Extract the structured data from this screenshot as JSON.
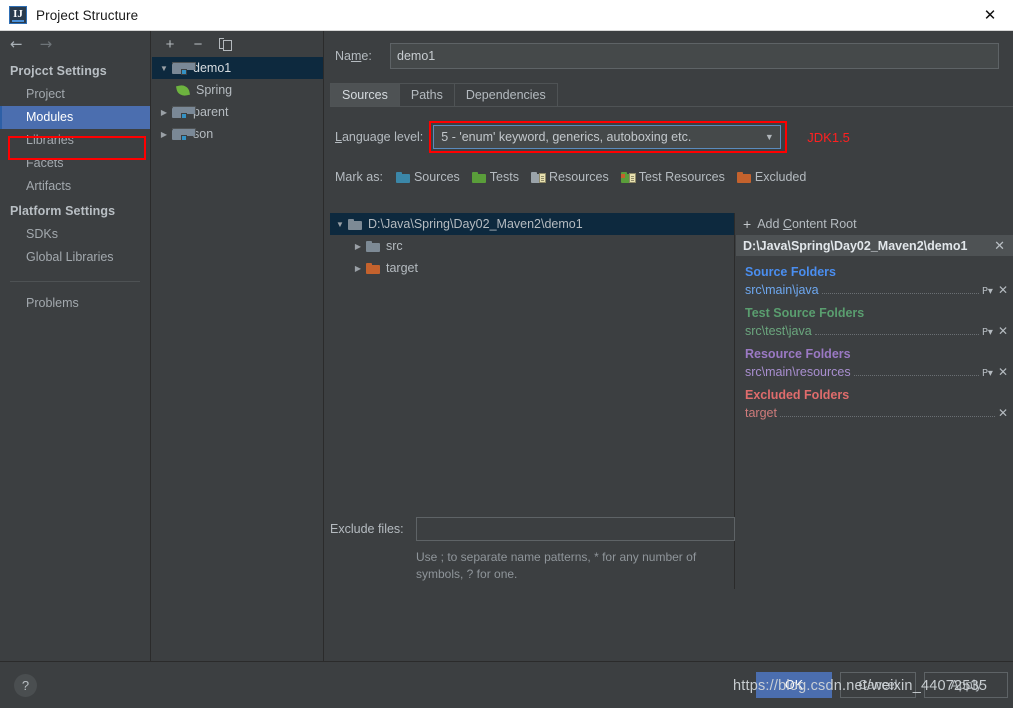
{
  "window": {
    "title": "Project Structure",
    "app_icon": "intellij-idea-icon",
    "close_label": "✕"
  },
  "sidebar": {
    "back_arrow": "←",
    "forward_arrow": "→",
    "groups": [
      {
        "title": "Projcct Settings",
        "items": [
          {
            "label": "Project",
            "selected": false
          },
          {
            "label": "Modules",
            "selected": true
          },
          {
            "label": "Libraries",
            "selected": false
          },
          {
            "label": "Facets",
            "selected": false
          },
          {
            "label": "Artifacts",
            "selected": false
          }
        ]
      },
      {
        "title": "Platform Settings",
        "items": [
          {
            "label": "SDKs",
            "selected": false
          },
          {
            "label": "Global Libraries",
            "selected": false
          }
        ]
      }
    ],
    "problems": "Problems"
  },
  "modules": {
    "toolbar": {
      "add": "+",
      "remove": "−",
      "copy": "copy"
    },
    "tree": [
      {
        "label": "demo1",
        "type": "module",
        "expanded": true,
        "selected": true,
        "indent": 0
      },
      {
        "label": "Spring",
        "type": "facet",
        "expanded": null,
        "selected": false,
        "indent": 1
      },
      {
        "label": "parent",
        "type": "module",
        "expanded": false,
        "selected": false,
        "indent": 0
      },
      {
        "label": "son",
        "type": "module",
        "expanded": false,
        "selected": false,
        "indent": 0
      }
    ]
  },
  "main": {
    "name_label_pre": "Na",
    "name_label_underline": "m",
    "name_label_post": "e:",
    "name_value": "demo1",
    "tabs": [
      {
        "label": "Sources",
        "active": true
      },
      {
        "label": "Paths",
        "active": false
      },
      {
        "label": "Dependencies",
        "active": false
      }
    ],
    "language_level": {
      "label_underline": "L",
      "label_rest": "anguage level:",
      "value": "5 - 'enum' keyword, generics, autoboxing etc.",
      "arrow": "▼",
      "annotation": "JDK1.5"
    },
    "mark_as": {
      "label": "Mark as:",
      "options": [
        {
          "label": "Sources",
          "accel": "S",
          "rest": "ources",
          "icon": "folder-blue-icon"
        },
        {
          "label": "Tests",
          "accel": "T",
          "rest": "ests",
          "icon": "folder-green-icon"
        },
        {
          "label": "Resources",
          "accel": "",
          "rest": "Resources",
          "icon": "folder-resources-icon"
        },
        {
          "label": "Test Resources",
          "accel": "",
          "rest": "Test Resources",
          "icon": "folder-test-resources-icon"
        },
        {
          "label": "Excluded",
          "accel": "E",
          "rest": "xcluded",
          "icon": "folder-orange-icon"
        }
      ]
    },
    "root_tree": [
      {
        "label": "D:\\Java\\Spring\\Day02_Maven2\\demo1",
        "expanded": true,
        "selected": true,
        "indent": 0,
        "icon": "folder-gray-icon"
      },
      {
        "label": "src",
        "expanded": false,
        "selected": false,
        "indent": 1,
        "icon": "folder-gray-icon"
      },
      {
        "label": "target",
        "expanded": false,
        "selected": false,
        "indent": 1,
        "icon": "folder-orange-icon"
      }
    ],
    "exclude_files": {
      "label": "Exclude files:",
      "value": "",
      "placeholder": "",
      "hint": "Use ; to separate name patterns, * for any number of symbols, ? for one."
    }
  },
  "content_roots": {
    "add_button": {
      "plus": "+",
      "label_pre": "Add ",
      "label_accel": "C",
      "label_post": "ontent Root"
    },
    "root_path": "D:\\Java\\Spring\\Day02_Maven2\\demo1",
    "root_close": "✕",
    "groups": [
      {
        "kind": "src",
        "title": "Source Folders",
        "color": "#4a8ef0",
        "entries": [
          {
            "path": "src\\main\\java",
            "has_package_prefix": true,
            "close": "✕"
          }
        ]
      },
      {
        "kind": "test",
        "title": "Test Source Folders",
        "color": "#5a9e6f",
        "entries": [
          {
            "path": "src\\test\\java",
            "has_package_prefix": true,
            "close": "✕"
          }
        ]
      },
      {
        "kind": "res",
        "title": "Resource Folders",
        "color": "#9b79c4",
        "entries": [
          {
            "path": "src\\main\\resources",
            "has_package_prefix": true,
            "close": "✕"
          }
        ]
      },
      {
        "kind": "exc",
        "title": "Excluded Folders",
        "color": "#e06c6c",
        "entries": [
          {
            "path": "target",
            "has_package_prefix": false,
            "close": "✕"
          }
        ]
      }
    ],
    "package_prefix_icon": "P▾"
  },
  "footer": {
    "help": "?",
    "ok": "OK",
    "cancel": "Cancel",
    "apply": "Apply"
  },
  "watermark": "https://blog.csdn.net/weixin_44072535",
  "colors": {
    "background": "#3c3f41",
    "selection_blue": "#4b6eaf",
    "tree_selection": "#0d293e",
    "highlight_red": "#ff0000",
    "annotation_red": "#ff2020",
    "source_folder": "#4a8ef0",
    "test_folder": "#5a9e6f",
    "resource_folder": "#9b79c4",
    "excluded_folder": "#e06c6c"
  }
}
